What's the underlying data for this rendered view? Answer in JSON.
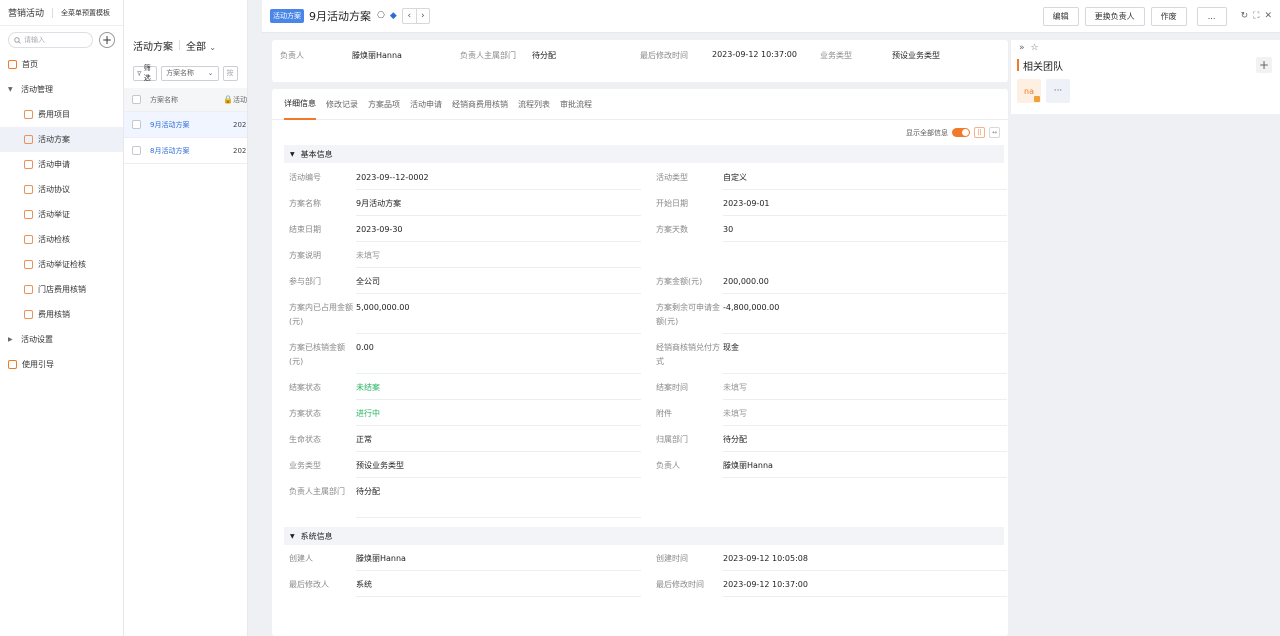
{
  "sidebar": {
    "app_title": "营销活动",
    "template": "全菜单预置模板",
    "search_placeholder": "请输入",
    "items": [
      {
        "label": "首页",
        "level": 0
      },
      {
        "label": "活动管理",
        "level": 0,
        "expanded": true
      },
      {
        "label": "费用项目",
        "level": 1
      },
      {
        "label": "活动方案",
        "level": 1,
        "active": true
      },
      {
        "label": "活动申请",
        "level": 1
      },
      {
        "label": "活动协议",
        "level": 1
      },
      {
        "label": "活动举证",
        "level": 1
      },
      {
        "label": "活动检核",
        "level": 1
      },
      {
        "label": "活动举证检核",
        "level": 1
      },
      {
        "label": "门店费用核销",
        "level": 1
      },
      {
        "label": "费用核销",
        "level": 1
      },
      {
        "label": "活动设置",
        "level": 0,
        "collapsed": true
      },
      {
        "label": "使用引导",
        "level": 0
      }
    ]
  },
  "list": {
    "title": "活动方案",
    "scope": "全部",
    "filter_label": "筛选",
    "field_select": "方案名称",
    "more_select": "按",
    "columns": [
      "方案名称",
      "活动"
    ],
    "rows": [
      {
        "name": "9月活动方案",
        "col2": "202"
      },
      {
        "name": "8月活动方案",
        "col2": "202"
      }
    ]
  },
  "header": {
    "tag": "活动方案",
    "title": "9月活动方案",
    "actions": [
      "编辑",
      "更换负责人",
      "作废",
      "..."
    ]
  },
  "summary": [
    {
      "label": "负责人",
      "value": "滕焕丽Hanna"
    },
    {
      "label": "负责人主属部门",
      "value": "待分配"
    },
    {
      "label": "最后修改时间",
      "value": "2023-09-12 10:37:00"
    },
    {
      "label": "业务类型",
      "value": "预设业务类型"
    }
  ],
  "tabs": [
    "详细信息",
    "修改记录",
    "方案品项",
    "活动申请",
    "经销商费用核销",
    "流程列表",
    "审批流程"
  ],
  "show_all_label": "显示全部信息",
  "basic": {
    "title": "基本信息",
    "fields": [
      {
        "label": "活动编号",
        "value": "2023-09--12-0002"
      },
      {
        "label": "活动类型",
        "value": "自定义"
      },
      {
        "label": "方案名称",
        "value": "9月活动方案"
      },
      {
        "label": "开始日期",
        "value": "2023-09-01"
      },
      {
        "label": "结束日期",
        "value": "2023-09-30"
      },
      {
        "label": "方案天数",
        "value": "30"
      },
      {
        "label": "方案说明",
        "value": "未填写",
        "style": "muted"
      },
      {
        "label": "",
        "value": ""
      },
      {
        "label": "参与部门",
        "value": "全公司"
      },
      {
        "label": "方案金额(元)",
        "value": "200,000.00"
      },
      {
        "label": "方案内已占用金额(元)",
        "value": "5,000,000.00",
        "tall": true
      },
      {
        "label": "方案剩余可申请金额(元)",
        "value": "-4,800,000.00",
        "tall": true
      },
      {
        "label": "方案已核销金额(元)",
        "value": "0.00",
        "tall": true
      },
      {
        "label": "经销商核销兑付方式",
        "value": "现金",
        "tall": true
      },
      {
        "label": "结案状态",
        "value": "未结案",
        "style": "green"
      },
      {
        "label": "结案时间",
        "value": "未填写",
        "style": "muted"
      },
      {
        "label": "方案状态",
        "value": "进行中",
        "style": "green"
      },
      {
        "label": "附件",
        "value": "未填写",
        "style": "muted"
      },
      {
        "label": "生命状态",
        "value": "正常"
      },
      {
        "label": "归属部门",
        "value": "待分配"
      },
      {
        "label": "业务类型",
        "value": "预设业务类型"
      },
      {
        "label": "负责人",
        "value": "滕焕丽Hanna"
      },
      {
        "label": "负责人主属部门",
        "value": "待分配",
        "tall": true
      }
    ]
  },
  "system": {
    "title": "系统信息",
    "fields": [
      {
        "label": "创建人",
        "value": "滕焕丽Hanna"
      },
      {
        "label": "创建时间",
        "value": "2023-09-12 10:05:08"
      },
      {
        "label": "最后修改人",
        "value": "系统"
      },
      {
        "label": "最后修改时间",
        "value": "2023-09-12 10:37:00"
      }
    ]
  },
  "team": {
    "title": "相关团队",
    "member": "na",
    "more": "···"
  },
  "colors": {
    "accent": "#f07a2a",
    "link": "#2d6bd6",
    "tag": "#4a86e8",
    "green": "#28b463"
  }
}
